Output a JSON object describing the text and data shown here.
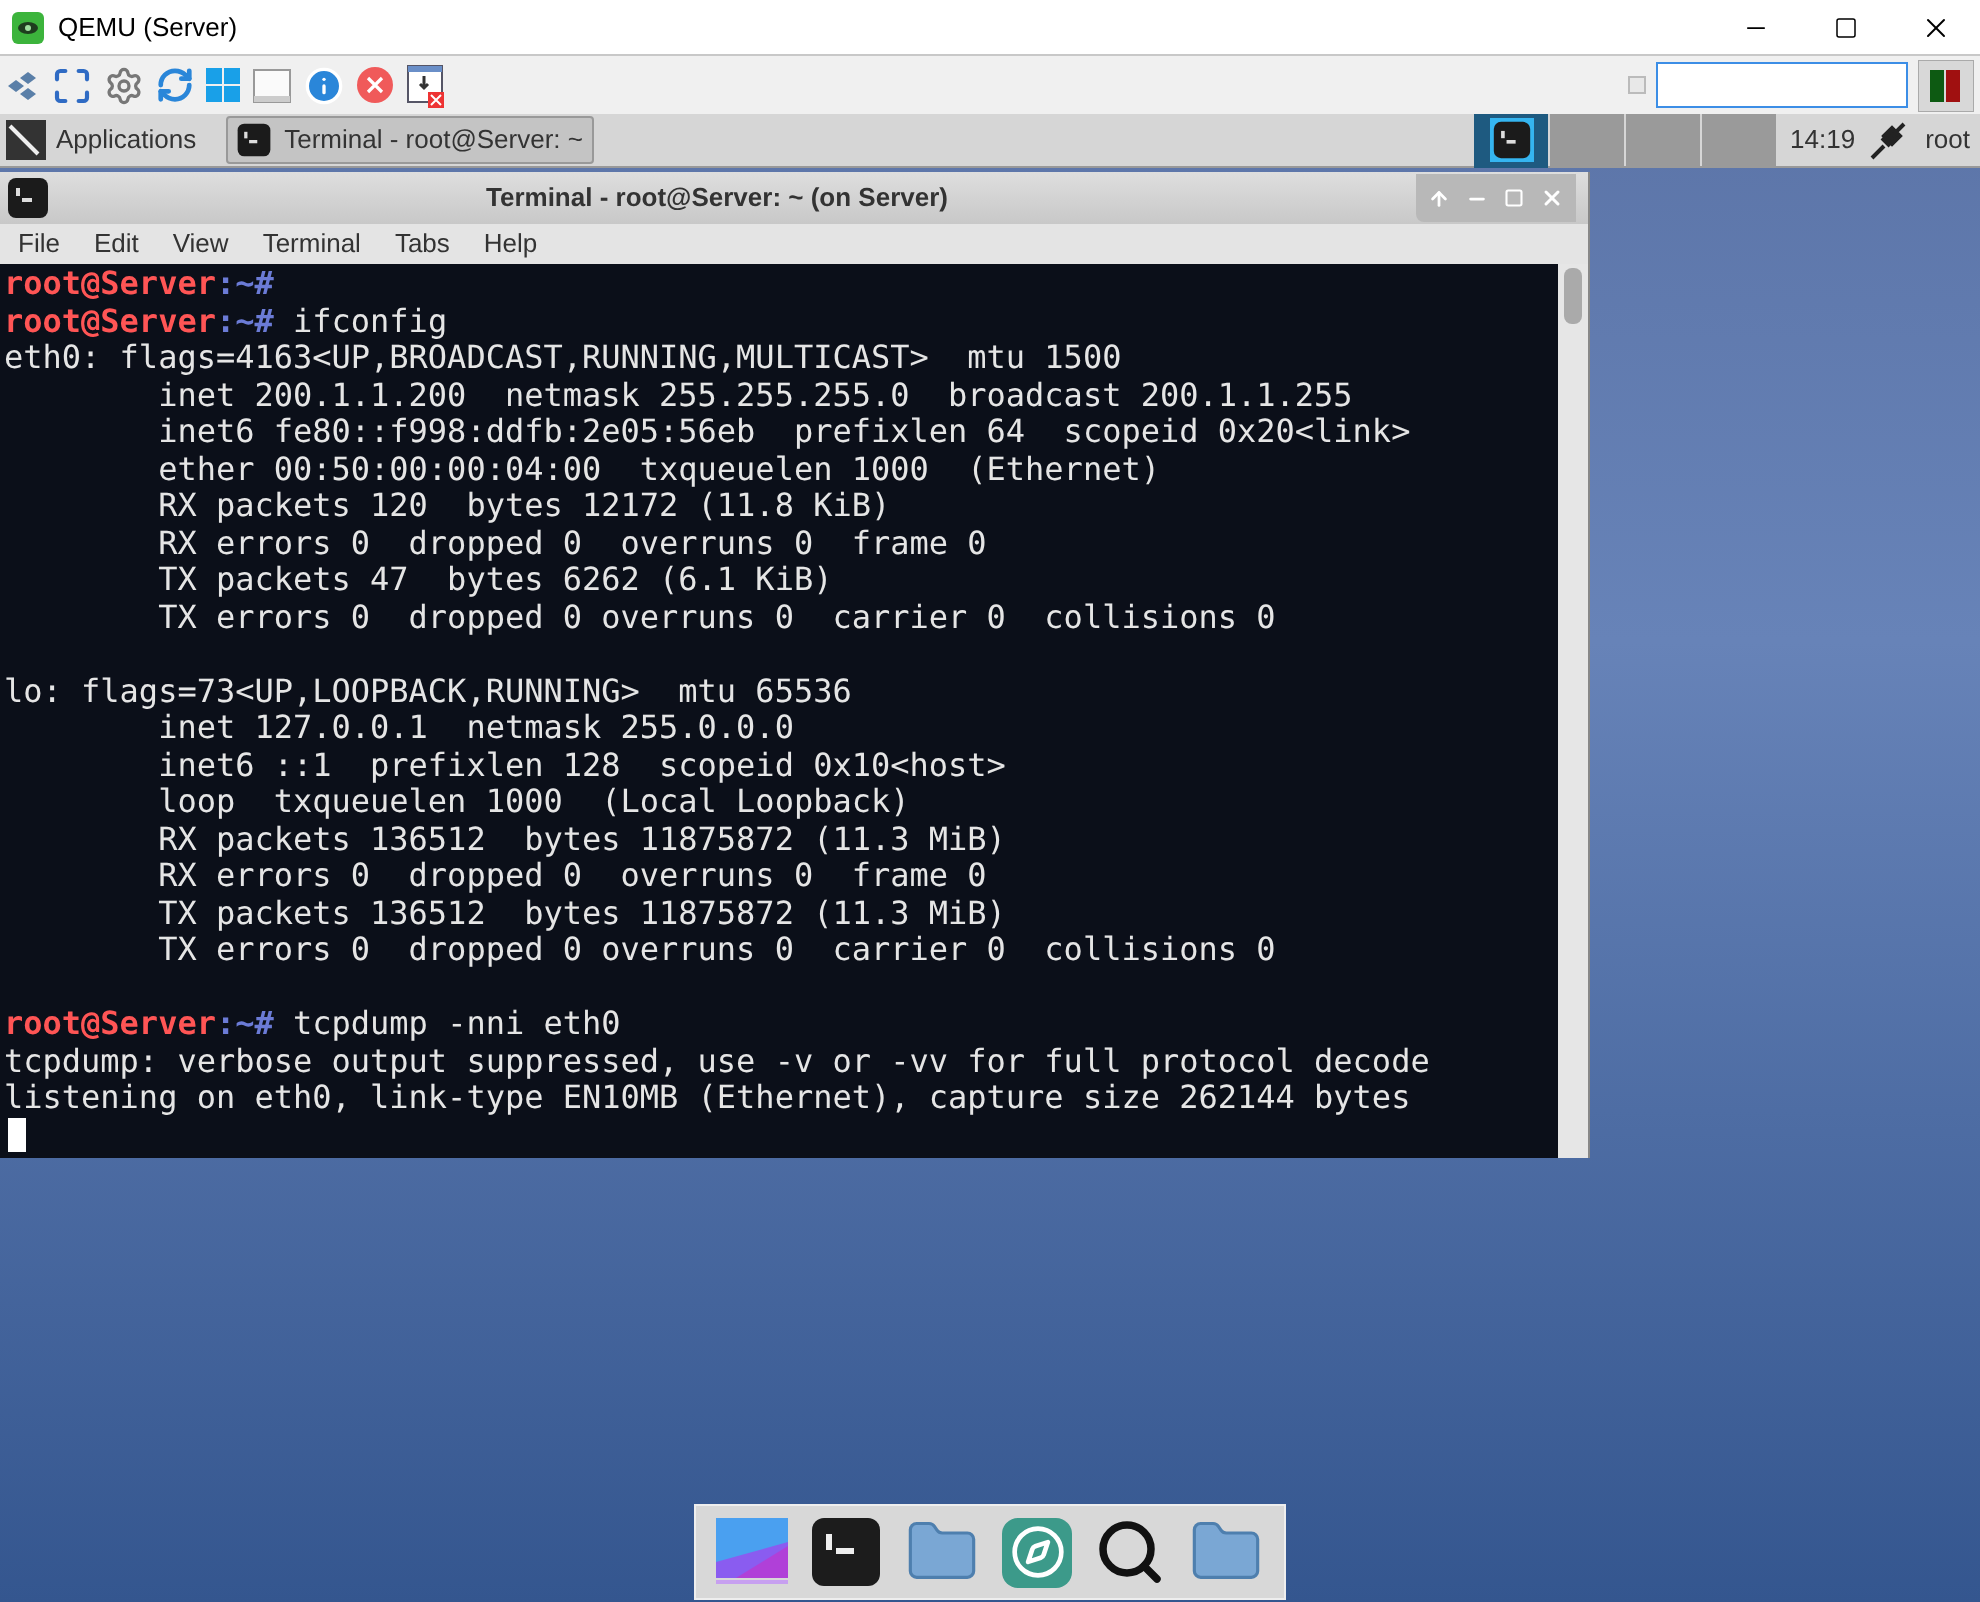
{
  "window": {
    "title": "QEMU (Server)"
  },
  "panel": {
    "applications": "Applications",
    "tasks": [
      {
        "label": "Terminal - root@Server: ~",
        "selected": true
      }
    ],
    "workspaces": [
      {
        "selected": true
      },
      {
        "selected": false
      },
      {
        "selected": false
      },
      {
        "selected": false
      }
    ],
    "clock": "14:19",
    "user": "root"
  },
  "terminal": {
    "title": "Terminal - root@Server: ~ (on Server)",
    "menu": [
      "File",
      "Edit",
      "View",
      "Terminal",
      "Tabs",
      "Help"
    ],
    "lines": [
      {
        "kind": "prompt",
        "user": "root@Server",
        "path": ":~#"
      },
      {
        "kind": "prompt",
        "user": "root@Server",
        "path": ":~#",
        "command": " ifconfig"
      },
      {
        "kind": "output",
        "text": "eth0: flags=4163<UP,BROADCAST,RUNNING,MULTICAST>  mtu 1500"
      },
      {
        "kind": "output",
        "text": "        inet 200.1.1.200  netmask 255.255.255.0  broadcast 200.1.1.255"
      },
      {
        "kind": "output",
        "text": "        inet6 fe80::f998:ddfb:2e05:56eb  prefixlen 64  scopeid 0x20<link>"
      },
      {
        "kind": "output",
        "text": "        ether 00:50:00:00:04:00  txqueuelen 1000  (Ethernet)"
      },
      {
        "kind": "output",
        "text": "        RX packets 120  bytes 12172 (11.8 KiB)"
      },
      {
        "kind": "output",
        "text": "        RX errors 0  dropped 0  overruns 0  frame 0"
      },
      {
        "kind": "output",
        "text": "        TX packets 47  bytes 6262 (6.1 KiB)"
      },
      {
        "kind": "output",
        "text": "        TX errors 0  dropped 0 overruns 0  carrier 0  collisions 0"
      },
      {
        "kind": "blank"
      },
      {
        "kind": "output",
        "text": "lo: flags=73<UP,LOOPBACK,RUNNING>  mtu 65536"
      },
      {
        "kind": "output",
        "text": "        inet 127.0.0.1  netmask 255.0.0.0"
      },
      {
        "kind": "output",
        "text": "        inet6 ::1  prefixlen 128  scopeid 0x10<host>"
      },
      {
        "kind": "output",
        "text": "        loop  txqueuelen 1000  (Local Loopback)"
      },
      {
        "kind": "output",
        "text": "        RX packets 136512  bytes 11875872 (11.3 MiB)"
      },
      {
        "kind": "output",
        "text": "        RX errors 0  dropped 0  overruns 0  frame 0"
      },
      {
        "kind": "output",
        "text": "        TX packets 136512  bytes 11875872 (11.3 MiB)"
      },
      {
        "kind": "output",
        "text": "        TX errors 0  dropped 0 overruns 0  carrier 0  collisions 0"
      },
      {
        "kind": "blank"
      },
      {
        "kind": "prompt",
        "user": "root@Server",
        "path": ":~#",
        "command": " tcpdump -nni eth0"
      },
      {
        "kind": "output",
        "text": "tcpdump: verbose output suppressed, use -v or -vv for full protocol decode"
      },
      {
        "kind": "output",
        "text": "listening on eth0, link-type EN10MB (Ethernet), capture size 262144 bytes"
      },
      {
        "kind": "cursor"
      }
    ]
  }
}
